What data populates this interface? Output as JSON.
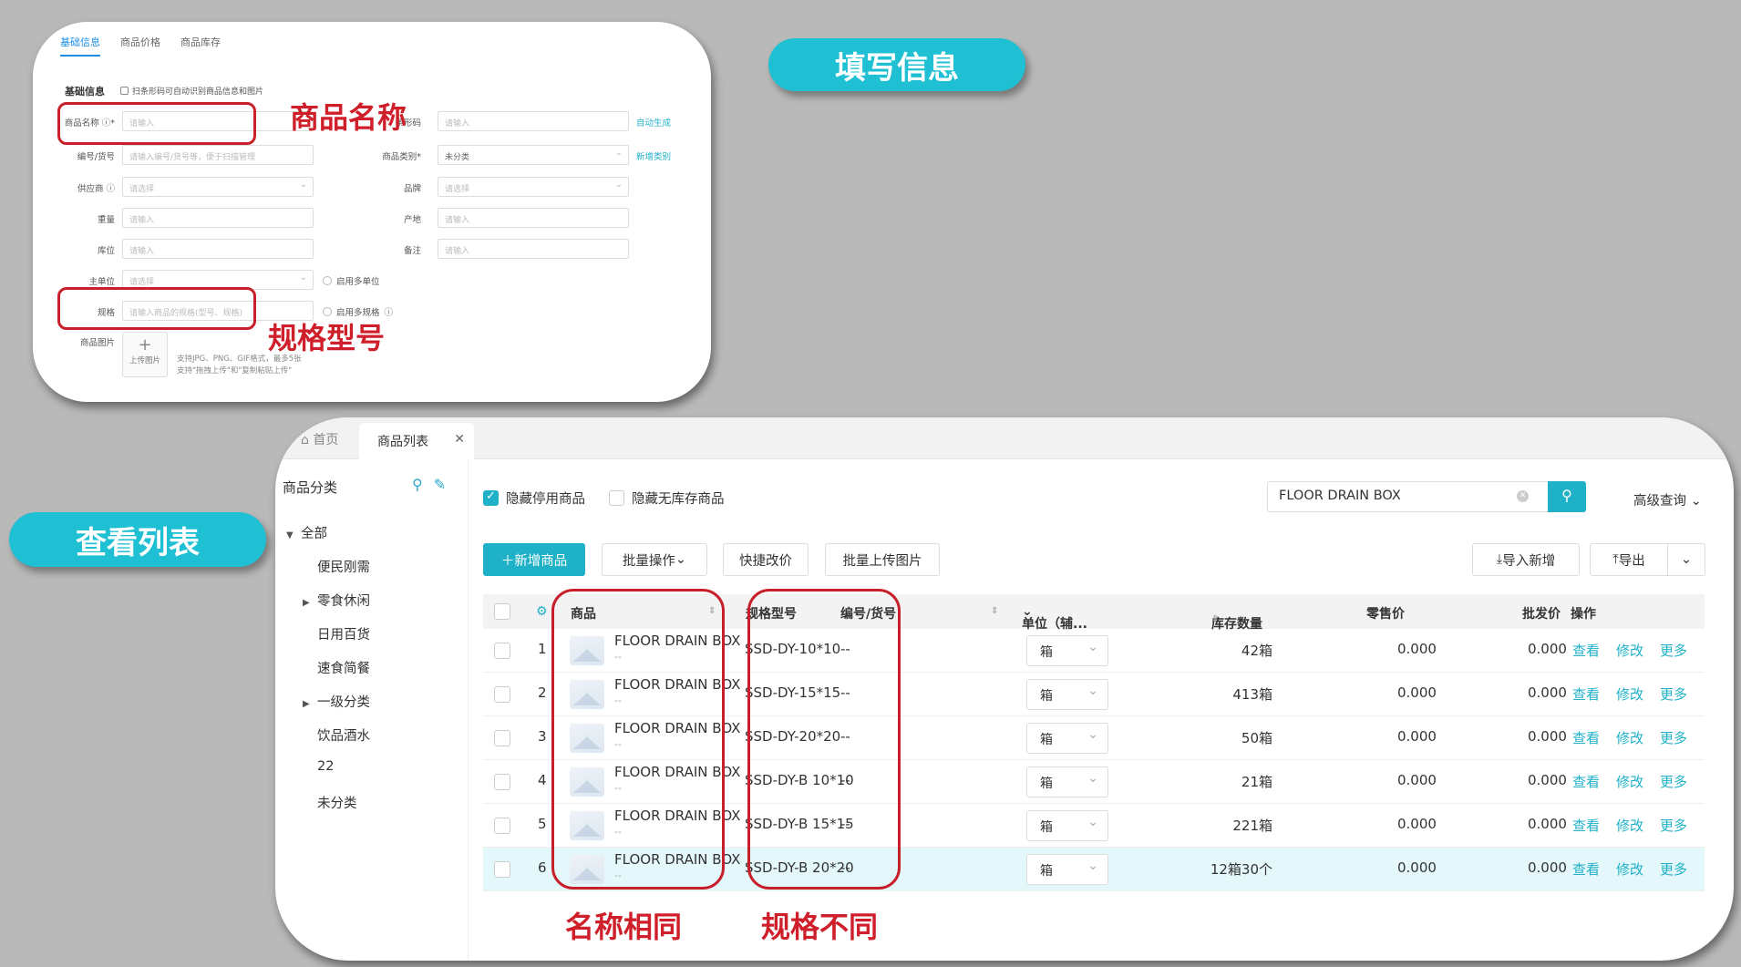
{
  "pills": {
    "fill": "填写信息",
    "view": "查看列表"
  },
  "callouts": {
    "name": "商品名称",
    "spec": "规格型号",
    "same_name": "名称相同",
    "diff_spec": "规格不同"
  },
  "form": {
    "tabs": [
      "基础信息",
      "商品价格",
      "商品库存"
    ],
    "section_title": "基础信息",
    "scan_hint": "扫条形码可自动识别商品信息和图片",
    "labels": {
      "name": "商品名称",
      "barcode": "条形码",
      "code": "编号/货号",
      "category": "商品类别",
      "supplier": "供应商",
      "brand": "品牌",
      "weight": "重量",
      "origin": "产地",
      "location": "库位",
      "remark": "备注",
      "unit": "主单位",
      "spec": "规格",
      "image": "商品图片"
    },
    "placeholders": {
      "name": "请输入",
      "barcode": "请输入",
      "code": "请输入编号/货号等，便于扫描管理",
      "supplier": "请选择",
      "brand": "请选择",
      "weight": "请输入",
      "origin": "请输入",
      "location": "请输入",
      "remark": "请输入",
      "unit": "请选择",
      "spec": "请输入商品的规格(型号、规格)"
    },
    "category_value": "未分类",
    "links": {
      "auto": "自动生成",
      "new_cat": "新增类别"
    },
    "checks": {
      "multi_unit": "启用多单位",
      "multi_spec": "启用多规格"
    },
    "upload_label": "上传图片",
    "upload_note_1": "支持JPG、PNG、GIF格式，最多5张",
    "upload_note_2": "支持\"拖拽上传\"和\"复制粘贴上传\""
  },
  "list": {
    "tabs": {
      "home": "首页",
      "active": "商品列表"
    },
    "sidebar": {
      "title": "商品分类",
      "items": [
        "全部",
        "便民刚需",
        "零食休闲",
        "日用百货",
        "速食简餐",
        "一级分类",
        "饮品酒水",
        "22",
        "未分类"
      ]
    },
    "filters": {
      "hide_disabled": "隐藏停用商品",
      "hide_no_stock": "隐藏无库存商品"
    },
    "search_value": "FLOOR DRAIN BOX",
    "advanced": "高级查询",
    "buttons": {
      "add": "新增商品",
      "batch": "批量操作",
      "quick_price": "快捷改价",
      "batch_upload": "批量上传图片",
      "import": "导入新增",
      "export": "导出"
    },
    "columns": {
      "product": "商品",
      "spec": "规格型号",
      "code": "编号/货号",
      "unit": "单位（辅...",
      "stock": "库存数量",
      "retail": "零售价",
      "wholesale": "批发价",
      "ops": "操作"
    },
    "rows": [
      {
        "idx": "1",
        "name": "FLOOR DRAIN BOX",
        "sub": "--",
        "spec": "SSD-DY-10*10",
        "code": "--",
        "unit": "箱",
        "stock": "42箱",
        "retail": "0.000",
        "wholesale": "0.000"
      },
      {
        "idx": "2",
        "name": "FLOOR DRAIN BOX",
        "sub": "--",
        "spec": "SSD-DY-15*15",
        "code": "--",
        "unit": "箱",
        "stock": "413箱",
        "retail": "0.000",
        "wholesale": "0.000"
      },
      {
        "idx": "3",
        "name": "FLOOR DRAIN BOX",
        "sub": "--",
        "spec": "SSD-DY-20*20",
        "code": "--",
        "unit": "箱",
        "stock": "50箱",
        "retail": "0.000",
        "wholesale": "0.000"
      },
      {
        "idx": "4",
        "name": "FLOOR DRAIN BOX",
        "sub": "--",
        "spec": "SSD-DY-B 10*10",
        "code": "--",
        "unit": "箱",
        "stock": "21箱",
        "retail": "0.000",
        "wholesale": "0.000"
      },
      {
        "idx": "5",
        "name": "FLOOR DRAIN BOX",
        "sub": "--",
        "spec": "SSD-DY-B 15*15",
        "code": "--",
        "unit": "箱",
        "stock": "221箱",
        "retail": "0.000",
        "wholesale": "0.000"
      },
      {
        "idx": "6",
        "name": "FLOOR DRAIN BOX",
        "sub": "--",
        "spec": "SSD-DY-B 20*20",
        "code": "--",
        "unit": "箱",
        "stock": "12箱30个",
        "retail": "0.000",
        "wholesale": "0.000"
      }
    ],
    "ops": {
      "view": "查看",
      "edit": "修改",
      "more": "更多"
    }
  },
  "colors": {
    "accent": "#1fc0d3",
    "highlight": "#c8202b",
    "link": "#1fb1c8",
    "background": "#b9b9b9"
  }
}
